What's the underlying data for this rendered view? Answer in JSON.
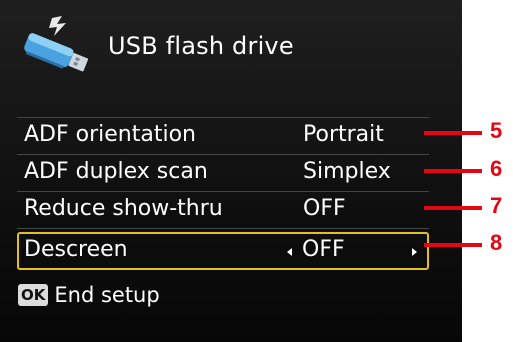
{
  "header": {
    "title": "USB flash drive",
    "icon": "usb-flash-drive-icon"
  },
  "settings": [
    {
      "label": "ADF orientation",
      "value": "Portrait",
      "selected": false
    },
    {
      "label": "ADF duplex scan",
      "value": "Simplex",
      "selected": false
    },
    {
      "label": "Reduce show-thru",
      "value": "OFF",
      "selected": false
    },
    {
      "label": "Descreen",
      "value": "OFF",
      "selected": true
    }
  ],
  "footer": {
    "ok_label": "OK",
    "action_label": "End setup"
  },
  "callouts": [
    "5",
    "6",
    "7",
    "8"
  ],
  "colors": {
    "screen_bg": "#141414",
    "text": "#ffffff",
    "selection_border": "#e2c11e",
    "callout": "#e30613"
  }
}
